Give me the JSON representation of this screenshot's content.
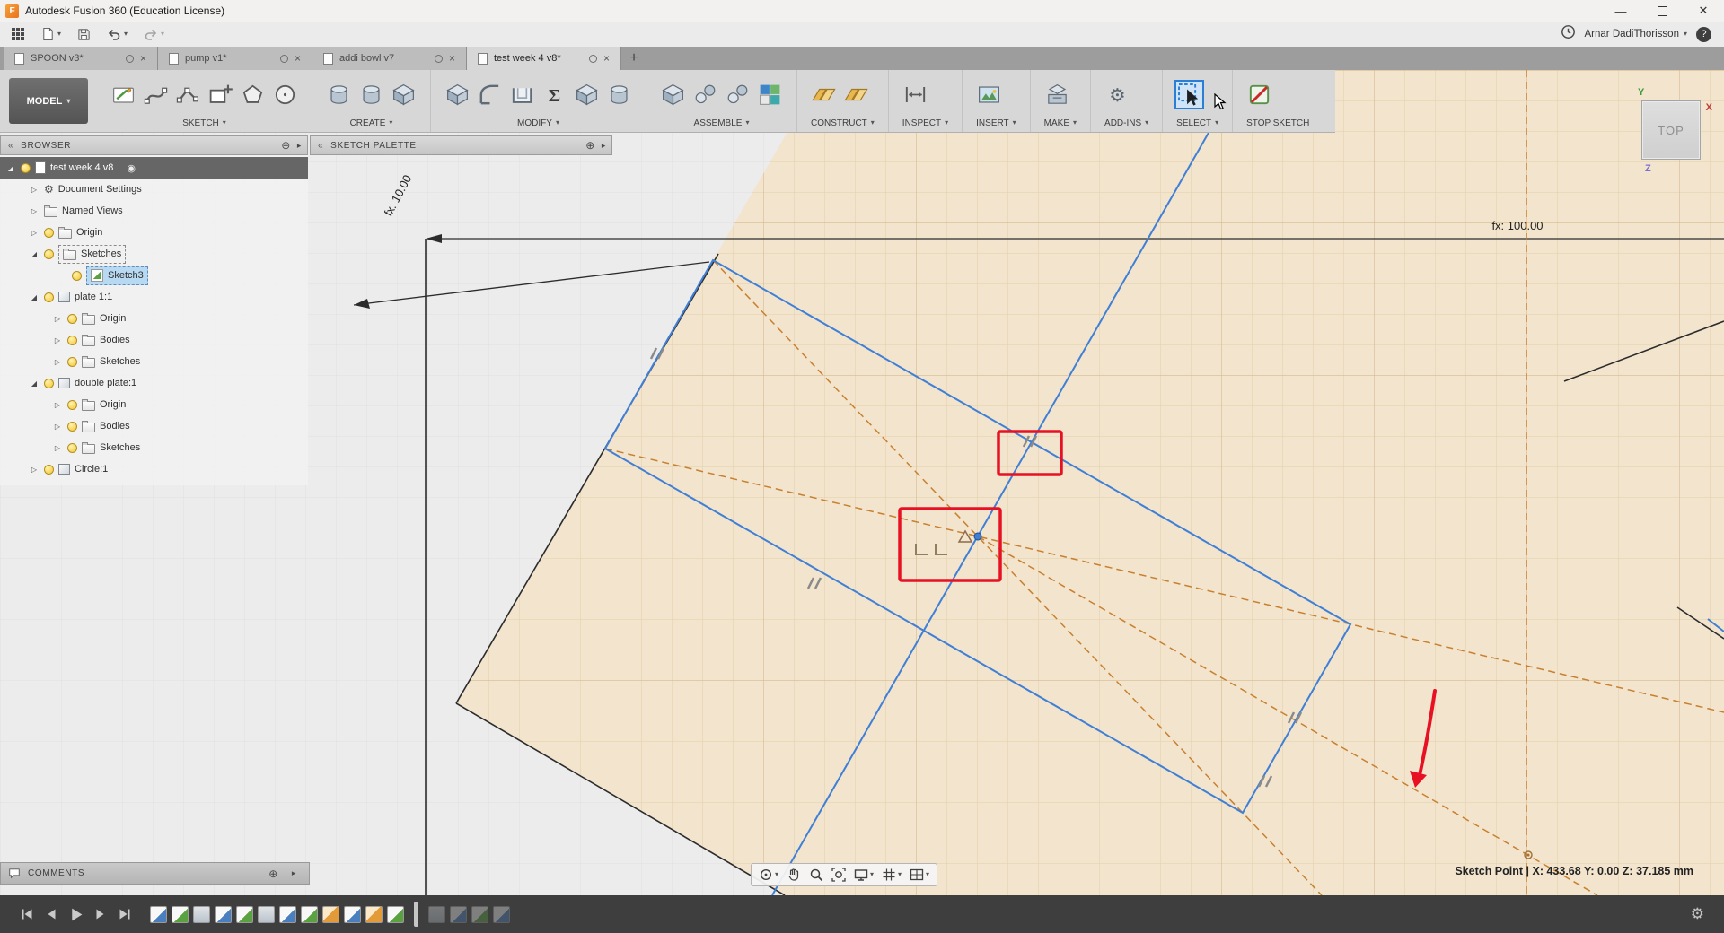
{
  "titlebar": {
    "title": "Autodesk Fusion 360 (Education License)"
  },
  "menubar": {
    "user": "Arnar DadiThorisson",
    "icons": [
      "apps-grid",
      "file-menu",
      "save",
      "undo",
      "redo",
      "job-status-clock",
      "help"
    ]
  },
  "tabs": [
    {
      "label": "SPOON v3*"
    },
    {
      "label": "pump v1*"
    },
    {
      "label": "addi bowl v7"
    },
    {
      "label": "test week 4 v8*"
    }
  ],
  "ribbon": {
    "model_label": "MODEL",
    "groups": [
      {
        "label": "SKETCH"
      },
      {
        "label": "CREATE"
      },
      {
        "label": "MODIFY"
      },
      {
        "label": "ASSEMBLE"
      },
      {
        "label": "CONSTRUCT"
      },
      {
        "label": "INSPECT"
      },
      {
        "label": "INSERT"
      },
      {
        "label": "MAKE"
      },
      {
        "label": "ADD-INS"
      },
      {
        "label": "SELECT"
      },
      {
        "label": "STOP SKETCH"
      }
    ]
  },
  "browser": {
    "title": "BROWSER",
    "rows": [
      {
        "label": "test week 4 v8"
      },
      {
        "label": "Document Settings"
      },
      {
        "label": "Named Views"
      },
      {
        "label": "Origin"
      },
      {
        "label": "Sketches"
      },
      {
        "label": "Sketch3"
      },
      {
        "label": "plate 1:1"
      },
      {
        "label": "Origin"
      },
      {
        "label": "Bodies"
      },
      {
        "label": "Sketches"
      },
      {
        "label": "double plate:1"
      },
      {
        "label": "Origin"
      },
      {
        "label": "Bodies"
      },
      {
        "label": "Sketches"
      },
      {
        "label": "Circle:1"
      }
    ]
  },
  "palette": {
    "title": "SKETCH PALETTE"
  },
  "comments": {
    "title": "COMMENTS"
  },
  "canvas": {
    "dim_width": "fx: 100.00",
    "dim_height": "fx: 10.00",
    "viewcube_face": "TOP",
    "axis_x": "X",
    "axis_y": "Y",
    "axis_z": "Z",
    "status": "Sketch Point | X: 433.68 Y: 0.00 Z: 37.185 mm"
  },
  "timeline": {
    "feature_icons": [
      "sketch-blue",
      "sketch-green",
      "body",
      "sketch-blue",
      "sketch-green",
      "body",
      "sketch-blue",
      "sketch-green",
      "sketch-orange",
      "sketch-blue",
      "sketch-orange",
      "sketch-green",
      "marker",
      "body-dim",
      "sketch-blue-dim",
      "sketch-green-dim",
      "sketch-blue-dim"
    ]
  },
  "colors": {
    "sketch_blue": "#3f7fd6",
    "construction_orange": "#c8802f",
    "annotation_red": "#e81123",
    "plane_tan": "#f2e4cd",
    "select_highlight": "#2a7fd4"
  }
}
